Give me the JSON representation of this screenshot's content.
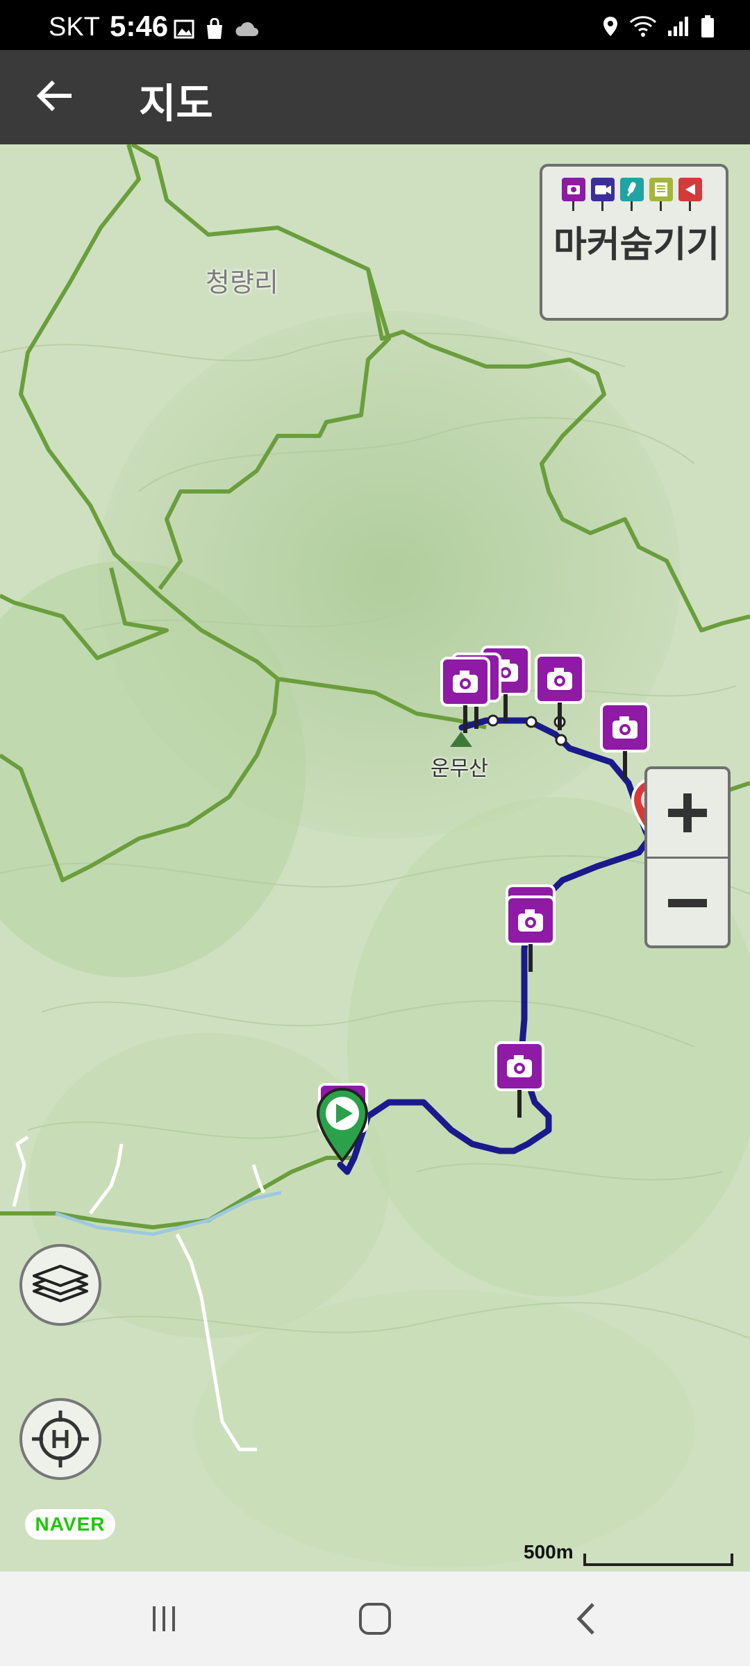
{
  "status_bar": {
    "carrier": "SKT",
    "time": "5:46",
    "icons_left": [
      "gallery-icon",
      "shopping-bag-icon",
      "cloud-icon"
    ],
    "icons_right": [
      "location-icon",
      "wifi-icon",
      "signal-icon",
      "battery-icon"
    ]
  },
  "toolbar": {
    "title": "지도",
    "back_icon": "arrow-left-icon"
  },
  "map": {
    "place_labels": [
      "청량리"
    ],
    "mountain_label": "운무산",
    "marker_panel": {
      "label": "마커숨기기",
      "flag_icons": [
        "camera-icon",
        "video-icon",
        "microphone-icon",
        "note-icon",
        "flag-icon"
      ],
      "flag_colors": [
        "#8e1aa6",
        "#3c2f9b",
        "#1fa3a3",
        "#a4b53a",
        "#d43a3a"
      ]
    },
    "zoom": {
      "in_icon": "plus-icon",
      "out_icon": "minus-icon"
    },
    "route_color": "#1a1a8c",
    "photo_marker_color": "#8e1aa6",
    "start_marker_color": "#2aa14a",
    "attribution": "NAVER",
    "scale_label": "500m"
  },
  "nav_bar": {
    "recent_icon": "recent-apps-icon",
    "home_icon": "home-icon",
    "back_icon": "back-icon"
  }
}
